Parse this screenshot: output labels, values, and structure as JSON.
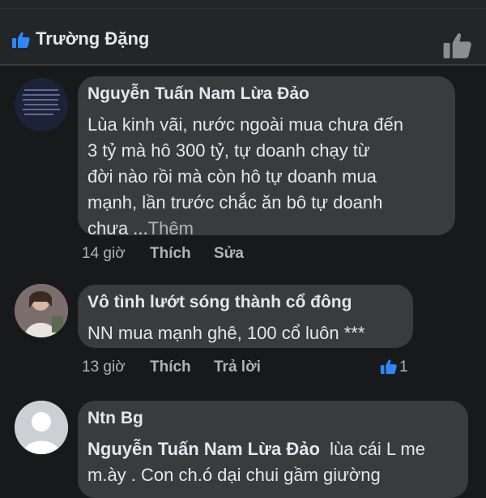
{
  "liker": {
    "name": "Trường Đặng"
  },
  "comments": [
    {
      "author": "Nguyễn Tuấn Nam Lừa Đảo",
      "lines": [
        "Lùa kinh vãi, nước ngoài mua chưa đến",
        "3 tỷ mà hô 300 tỷ, tự doanh chạy từ",
        "đời nào rồi mà còn hô tự doanh mua",
        "mạnh, lần trước chắc ăn bô tự doanh"
      ],
      "last_line": "chưa ...",
      "more": "Thêm",
      "time": "14 giờ",
      "like_label": "Thích",
      "action_label": "Sửa"
    },
    {
      "author": "Vô tình lướt sóng thành cổ đông",
      "text": "NN mua mạnh ghê, 100 cổ luôn ***",
      "time": "13 giờ",
      "like_label": "Thích",
      "action_label": "Trả lời",
      "reaction_count": "1"
    },
    {
      "author": "Ntn Bg",
      "mention": "Nguyễn Tuấn Nam Lừa Đảo",
      "text_after_mention": "  lùa cái L me",
      "line2": "m.ày . Con ch.ó dại chui gầm giường"
    }
  ],
  "colors": {
    "background": "#18191a",
    "header": "#242526",
    "bubble": "#3a3b3c",
    "accent": "#2d88ff",
    "text": "#e4e6eb",
    "muted": "#b0b3b8"
  },
  "icons": {
    "liker_icon": "thumbs-up-icon",
    "like_button": "thumbs-up-icon",
    "reaction": "thumbs-up-icon"
  }
}
